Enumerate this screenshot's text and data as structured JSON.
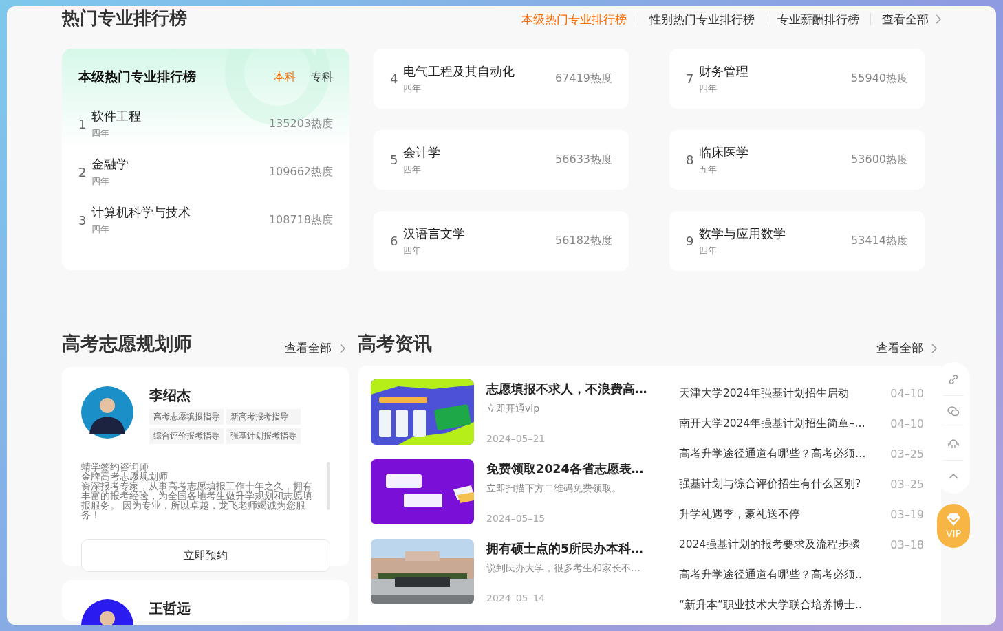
{
  "rankings": {
    "title": "热门专业排行榜",
    "tabs": [
      {
        "label": "本级热门专业排行榜",
        "selected": true
      },
      {
        "label": "性别热门专业排行榜",
        "selected": false
      },
      {
        "label": "专业薪酬排行榜",
        "selected": false
      }
    ],
    "view_all": "查看全部",
    "featured": {
      "title": "本级热门专业排行榜",
      "levels": [
        {
          "label": "本科",
          "selected": true
        },
        {
          "label": "专科",
          "selected": false
        }
      ],
      "items": [
        {
          "rank": "1",
          "name": "软件工程",
          "duration": "四年",
          "heat": "135203热度"
        },
        {
          "rank": "2",
          "name": "金融学",
          "duration": "四年",
          "heat": "109662热度"
        },
        {
          "rank": "3",
          "name": "计算机科学与技术",
          "duration": "四年",
          "heat": "108718热度"
        }
      ]
    },
    "cards": [
      {
        "rank": "4",
        "name": "电气工程及其自动化",
        "duration": "四年",
        "heat": "67419热度"
      },
      {
        "rank": "7",
        "name": "财务管理",
        "duration": "四年",
        "heat": "55940热度"
      },
      {
        "rank": "5",
        "name": "会计学",
        "duration": "四年",
        "heat": "56633热度"
      },
      {
        "rank": "8",
        "name": "临床医学",
        "duration": "五年",
        "heat": "53600热度"
      },
      {
        "rank": "6",
        "name": "汉语言文学",
        "duration": "四年",
        "heat": "56182热度"
      },
      {
        "rank": "9",
        "name": "数学与应用数学",
        "duration": "四年",
        "heat": "53414热度"
      }
    ]
  },
  "planners": {
    "title": "高考志愿规划师",
    "view_all": "查看全部",
    "items": [
      {
        "name": "李绍杰",
        "tags": [
          "高考志愿填报指导",
          "新高考报考指导",
          "综合评价报考指导",
          "强基计划报考指导"
        ],
        "bio": [
          "蜻学签约咨询师",
          "金牌高考志愿规划师",
          "资深报考专家，从事高考志愿填报工作十年之久，拥有丰富的报考经验，为全国各地考生做升学规划和志愿填报服务。 因为专业，所以卓越，龙飞老师竭诚为您服务！"
        ],
        "button": "立即预约"
      },
      {
        "name": "王哲远"
      }
    ]
  },
  "news": {
    "title": "高考资讯",
    "view_all": "查看全部",
    "featured": [
      {
        "title": "志愿填报不求人，不浪费高…",
        "summary": "立即开通vip",
        "date": "2024–05–21"
      },
      {
        "title": "免费领取2024各省志愿表…",
        "summary": "立即扫描下方二维码免费领取。",
        "date": "2024–05–15"
      },
      {
        "title": "拥有硕士点的5所民办本科…",
        "summary": "说到民办大学，很多考生和家长不…",
        "date": "2024–05–14"
      }
    ],
    "list": [
      {
        "title": "天津大学2024年强基计划招生启动",
        "date": "04–10"
      },
      {
        "title": "南开大学2024年强基计划招生简章–…",
        "date": "04–10"
      },
      {
        "title": "高考升学途径通道有哪些？高考必须…",
        "date": "03–25"
      },
      {
        "title": "强基计划与综合评价招生有什么区别?",
        "date": "03–25"
      },
      {
        "title": "升学礼遇季，豪礼送不停",
        "date": "03–19"
      },
      {
        "title": "2024强基计划的报考要求及流程步骤",
        "date": "03–18"
      },
      {
        "title": "高考升学途径通道有哪些？高考必须.."
      },
      {
        "title": "“新升本”职业技术大学联合培养博士.."
      }
    ]
  },
  "side_toolbar": {
    "vip_label": "VIP"
  }
}
